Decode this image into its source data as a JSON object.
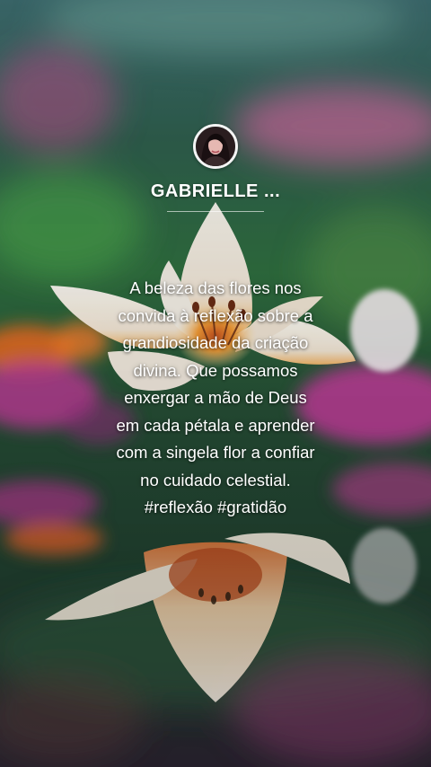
{
  "profile": {
    "username": "GABRIELLE ...",
    "avatar_icon": "person-avatar"
  },
  "post": {
    "lines": [
      "A beleza das flores nos",
      "convida à reflexão sobre a",
      "grandiosidade da criação",
      "divina. Que possamos",
      "enxergar a mão de Deus",
      "em cada pétala e aprender",
      "com a singela flor a confiar",
      "no cuidado celestial.",
      "#reflexão #gratidão"
    ]
  },
  "colors": {
    "text": "#ffffff",
    "petal": "#f4ece4",
    "flower_center": "#f39a35",
    "magenta_flowers": "#c13a96",
    "orange_flowers": "#e8642a",
    "background_green": "#2f6a44"
  }
}
